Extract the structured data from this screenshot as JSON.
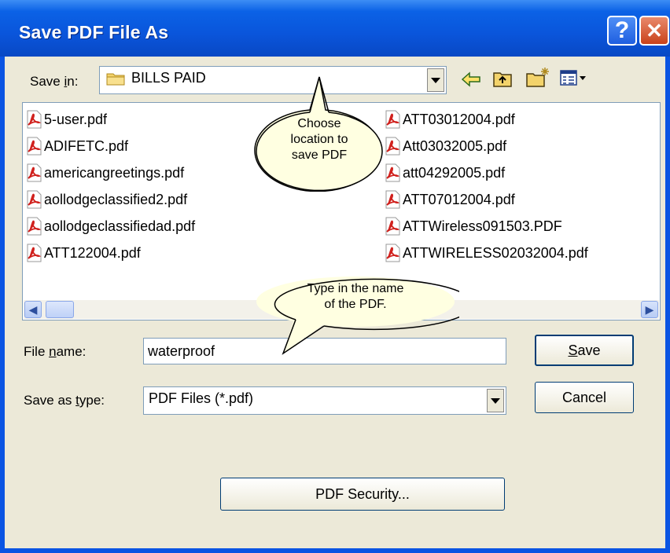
{
  "window": {
    "title": "Save PDF File As",
    "help_glyph": "?",
    "close_glyph": "✕"
  },
  "save_in": {
    "label_pre": "Save ",
    "label_ul": "i",
    "label_post": "n:",
    "value": "BILLS PAID"
  },
  "toolbar": {
    "back": "⇦",
    "up": "📁",
    "new_folder": "📁",
    "views": "▦"
  },
  "files": {
    "col1": [
      "5-user.pdf",
      "ADIFETC.pdf",
      "americangreetings.pdf",
      "aollodgeclassified2.pdf",
      "aollodgeclassifiedad.pdf",
      "ATT122004.pdf"
    ],
    "col2": [
      "ATT03012004.pdf",
      "Att03032005.pdf",
      "att04292005.pdf",
      "ATT07012004.pdf",
      "ATTWireless091503.PDF",
      "ATTWIRELESS02032004.pdf"
    ]
  },
  "file_name": {
    "label_pre": "File ",
    "label_ul": "n",
    "label_post": "ame:",
    "value": "waterproof"
  },
  "save_as_type": {
    "label_pre": "Save as ",
    "label_ul": "t",
    "label_post": "ype:",
    "value": "PDF Files (*.pdf)"
  },
  "buttons": {
    "save_ul": "S",
    "save_rest": "ave",
    "cancel": "Cancel",
    "security": "PDF Security..."
  },
  "callouts": {
    "location": [
      "Choose",
      "location to",
      "save PDF"
    ],
    "name": [
      "Type in the name",
      "of the PDF."
    ]
  },
  "colors": {
    "title_blue": "#0a54e3",
    "dialog_bg": "#ece9d8",
    "callout_fill": "#ffffe1"
  }
}
